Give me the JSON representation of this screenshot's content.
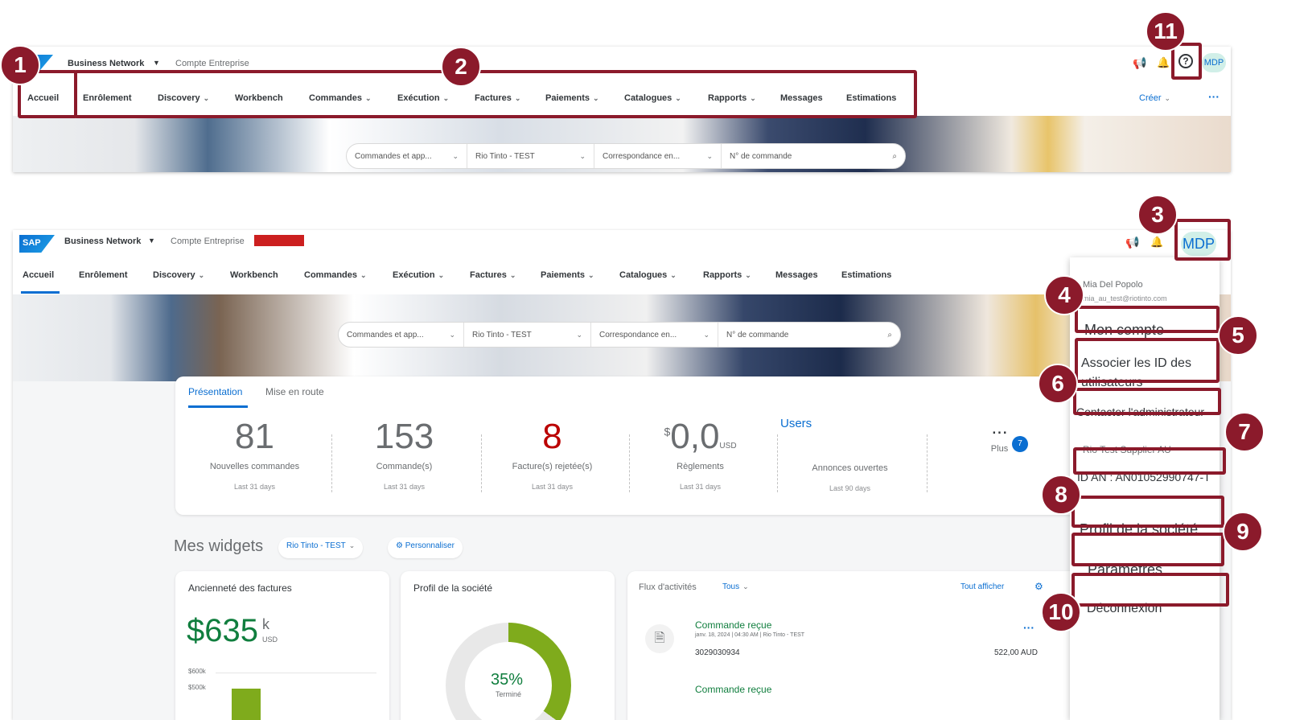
{
  "top": {
    "brand": "Business Network",
    "account": "Compte Entreprise",
    "nav": [
      "Accueil",
      "Enrôlement",
      "Discovery",
      "Workbench",
      "Commandes",
      "Exécution",
      "Factures",
      "Paiements",
      "Catalogues",
      "Rapports",
      "Messages",
      "Estimations"
    ],
    "nav_dropdown": [
      false,
      false,
      true,
      false,
      true,
      true,
      true,
      true,
      true,
      true,
      false,
      false
    ],
    "create": "Créer",
    "avatar": "MDP",
    "search": [
      "Commandes et app...",
      "Rio Tinto - TEST",
      "Correspondance en...",
      "N° de commande"
    ]
  },
  "main": {
    "brand": "Business Network",
    "account": "Compte Entreprise",
    "logo": "SAP",
    "nav": [
      "Accueil",
      "Enrôlement",
      "Discovery",
      "Workbench",
      "Commandes",
      "Exécution",
      "Factures",
      "Paiements",
      "Catalogues",
      "Rapports",
      "Messages",
      "Estimations"
    ],
    "nav_dropdown": [
      false,
      false,
      true,
      false,
      true,
      true,
      true,
      true,
      true,
      true,
      false,
      false
    ],
    "avatar": "MDP",
    "search": [
      "Commandes et app...",
      "Rio Tinto - TEST",
      "Correspondance en...",
      "N° de commande"
    ],
    "tabs": [
      "Présentation",
      "Mise en route"
    ],
    "kpis": [
      {
        "value": "81",
        "label": "Nouvelles commandes",
        "sub": "Last 31 days"
      },
      {
        "value": "153",
        "label": "Commande(s)",
        "sub": "Last 31 days"
      },
      {
        "value": "8",
        "label": "Facture(s) rejetée(s)",
        "sub": "Last 31 days"
      },
      {
        "currency": "$",
        "value": "0,0",
        "unit": "USD",
        "label": "Règlements",
        "sub": "Last 31 days"
      },
      {
        "value": "Users",
        "label": "Annonces ouvertes",
        "sub": "Last 90 days"
      },
      {
        "value": "...",
        "label": "Plus",
        "badge": "7"
      }
    ],
    "widgets_title": "Mes widgets",
    "widgets_filter": "Rio Tinto - TEST",
    "customize": "Personnaliser",
    "card1": {
      "title": "Ancienneté des factures",
      "value": "$635",
      "unit_top": "k",
      "unit_bottom": "USD",
      "axis": [
        "$600k",
        "$500k"
      ]
    },
    "card2": {
      "title": "Profil de la société",
      "percent": "35%",
      "progress": 0.35,
      "sublabel": "Terminé"
    },
    "card3": {
      "title": "Flux d'activités",
      "filter": "Tous",
      "show_all": "Tout afficher",
      "items": [
        {
          "title": "Commande reçue",
          "meta": "janv. 18, 2024 | 04:30 AM | Rio Tinto - TEST",
          "ref": "3029030934",
          "amount": "522,00 AUD"
        },
        {
          "title": "Commande reçue"
        }
      ]
    }
  },
  "menu": {
    "user_name": "Mia Del Popolo",
    "user_email": "mia_au_test@riotinto.com",
    "my_account": "Mon compte",
    "link_ids": "Associer les ID des utilisateurs",
    "contact_admin": "Contacter l'administrateur",
    "company": "Rio Test Supplier AU",
    "an_id": "ID AN : AN01052990747-T",
    "company_profile": "Profil de la société",
    "settings": "Paramètres",
    "logout": "Déconnexion"
  },
  "callouts": [
    "1",
    "2",
    "3",
    "4",
    "5",
    "6",
    "7",
    "8",
    "9",
    "10",
    "11"
  ],
  "colors": {
    "accent": "#0a6ed1",
    "callout": "#8b1a2b",
    "error": "#bb0000",
    "avatar_bg": "#d1efe8",
    "avatar_fg": "#0a6ed1",
    "progress": "#7fab1c"
  }
}
